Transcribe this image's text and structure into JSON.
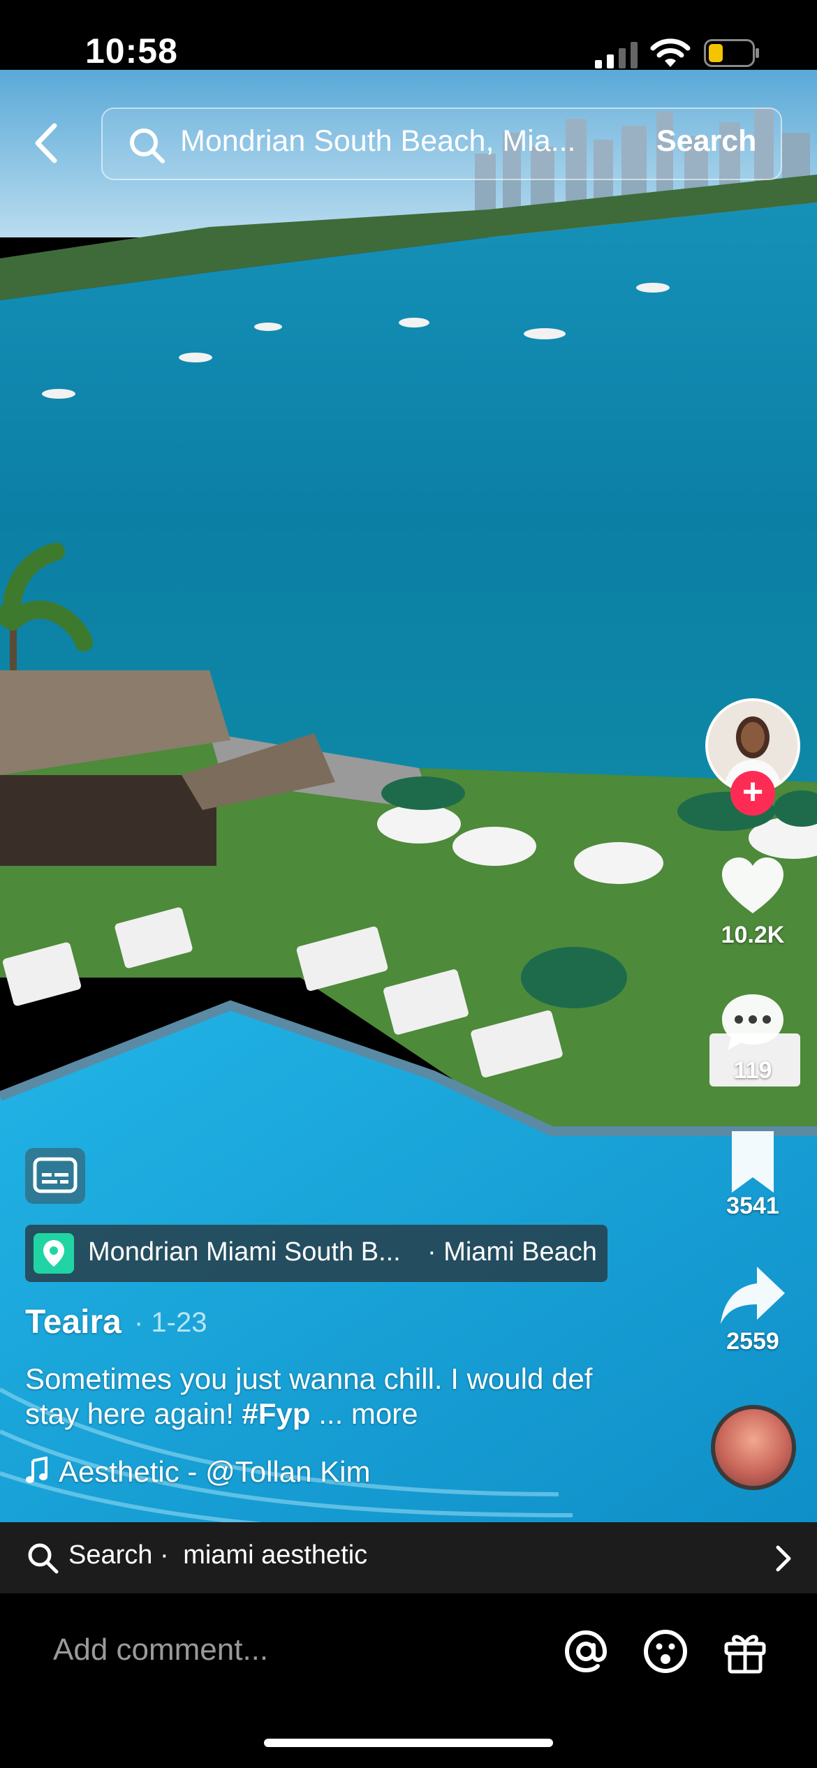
{
  "status_bar": {
    "time": "10:58",
    "signal_icon": "cellular-signal-icon",
    "wifi_icon": "wifi-icon",
    "battery_icon": "battery-low-icon",
    "battery_color": "#f5c400"
  },
  "top_search": {
    "query": "Mondrian South Beach, Mia...",
    "search_button": "Search"
  },
  "creator": {
    "username": "Teaira",
    "date": "· 1-23"
  },
  "location": {
    "name": "Mondrian Miami South B...",
    "city": "· Miami Beach"
  },
  "caption": {
    "text": "Sometimes you just wanna chill. I would def stay here again! ",
    "hashtag": "#Fyp",
    "more": "... more"
  },
  "music": {
    "track": "Aesthetic - @Tollan Kim"
  },
  "engagement": {
    "likes": "10.2K",
    "comments": "119",
    "saves": "3541",
    "shares": "2559"
  },
  "related_search": {
    "prefix": "Search ·",
    "query": "miami aesthetic"
  },
  "comment_bar": {
    "placeholder": "Add comment..."
  },
  "colors": {
    "accent": "#fe2c55",
    "location_pin": "#20d5a3"
  }
}
